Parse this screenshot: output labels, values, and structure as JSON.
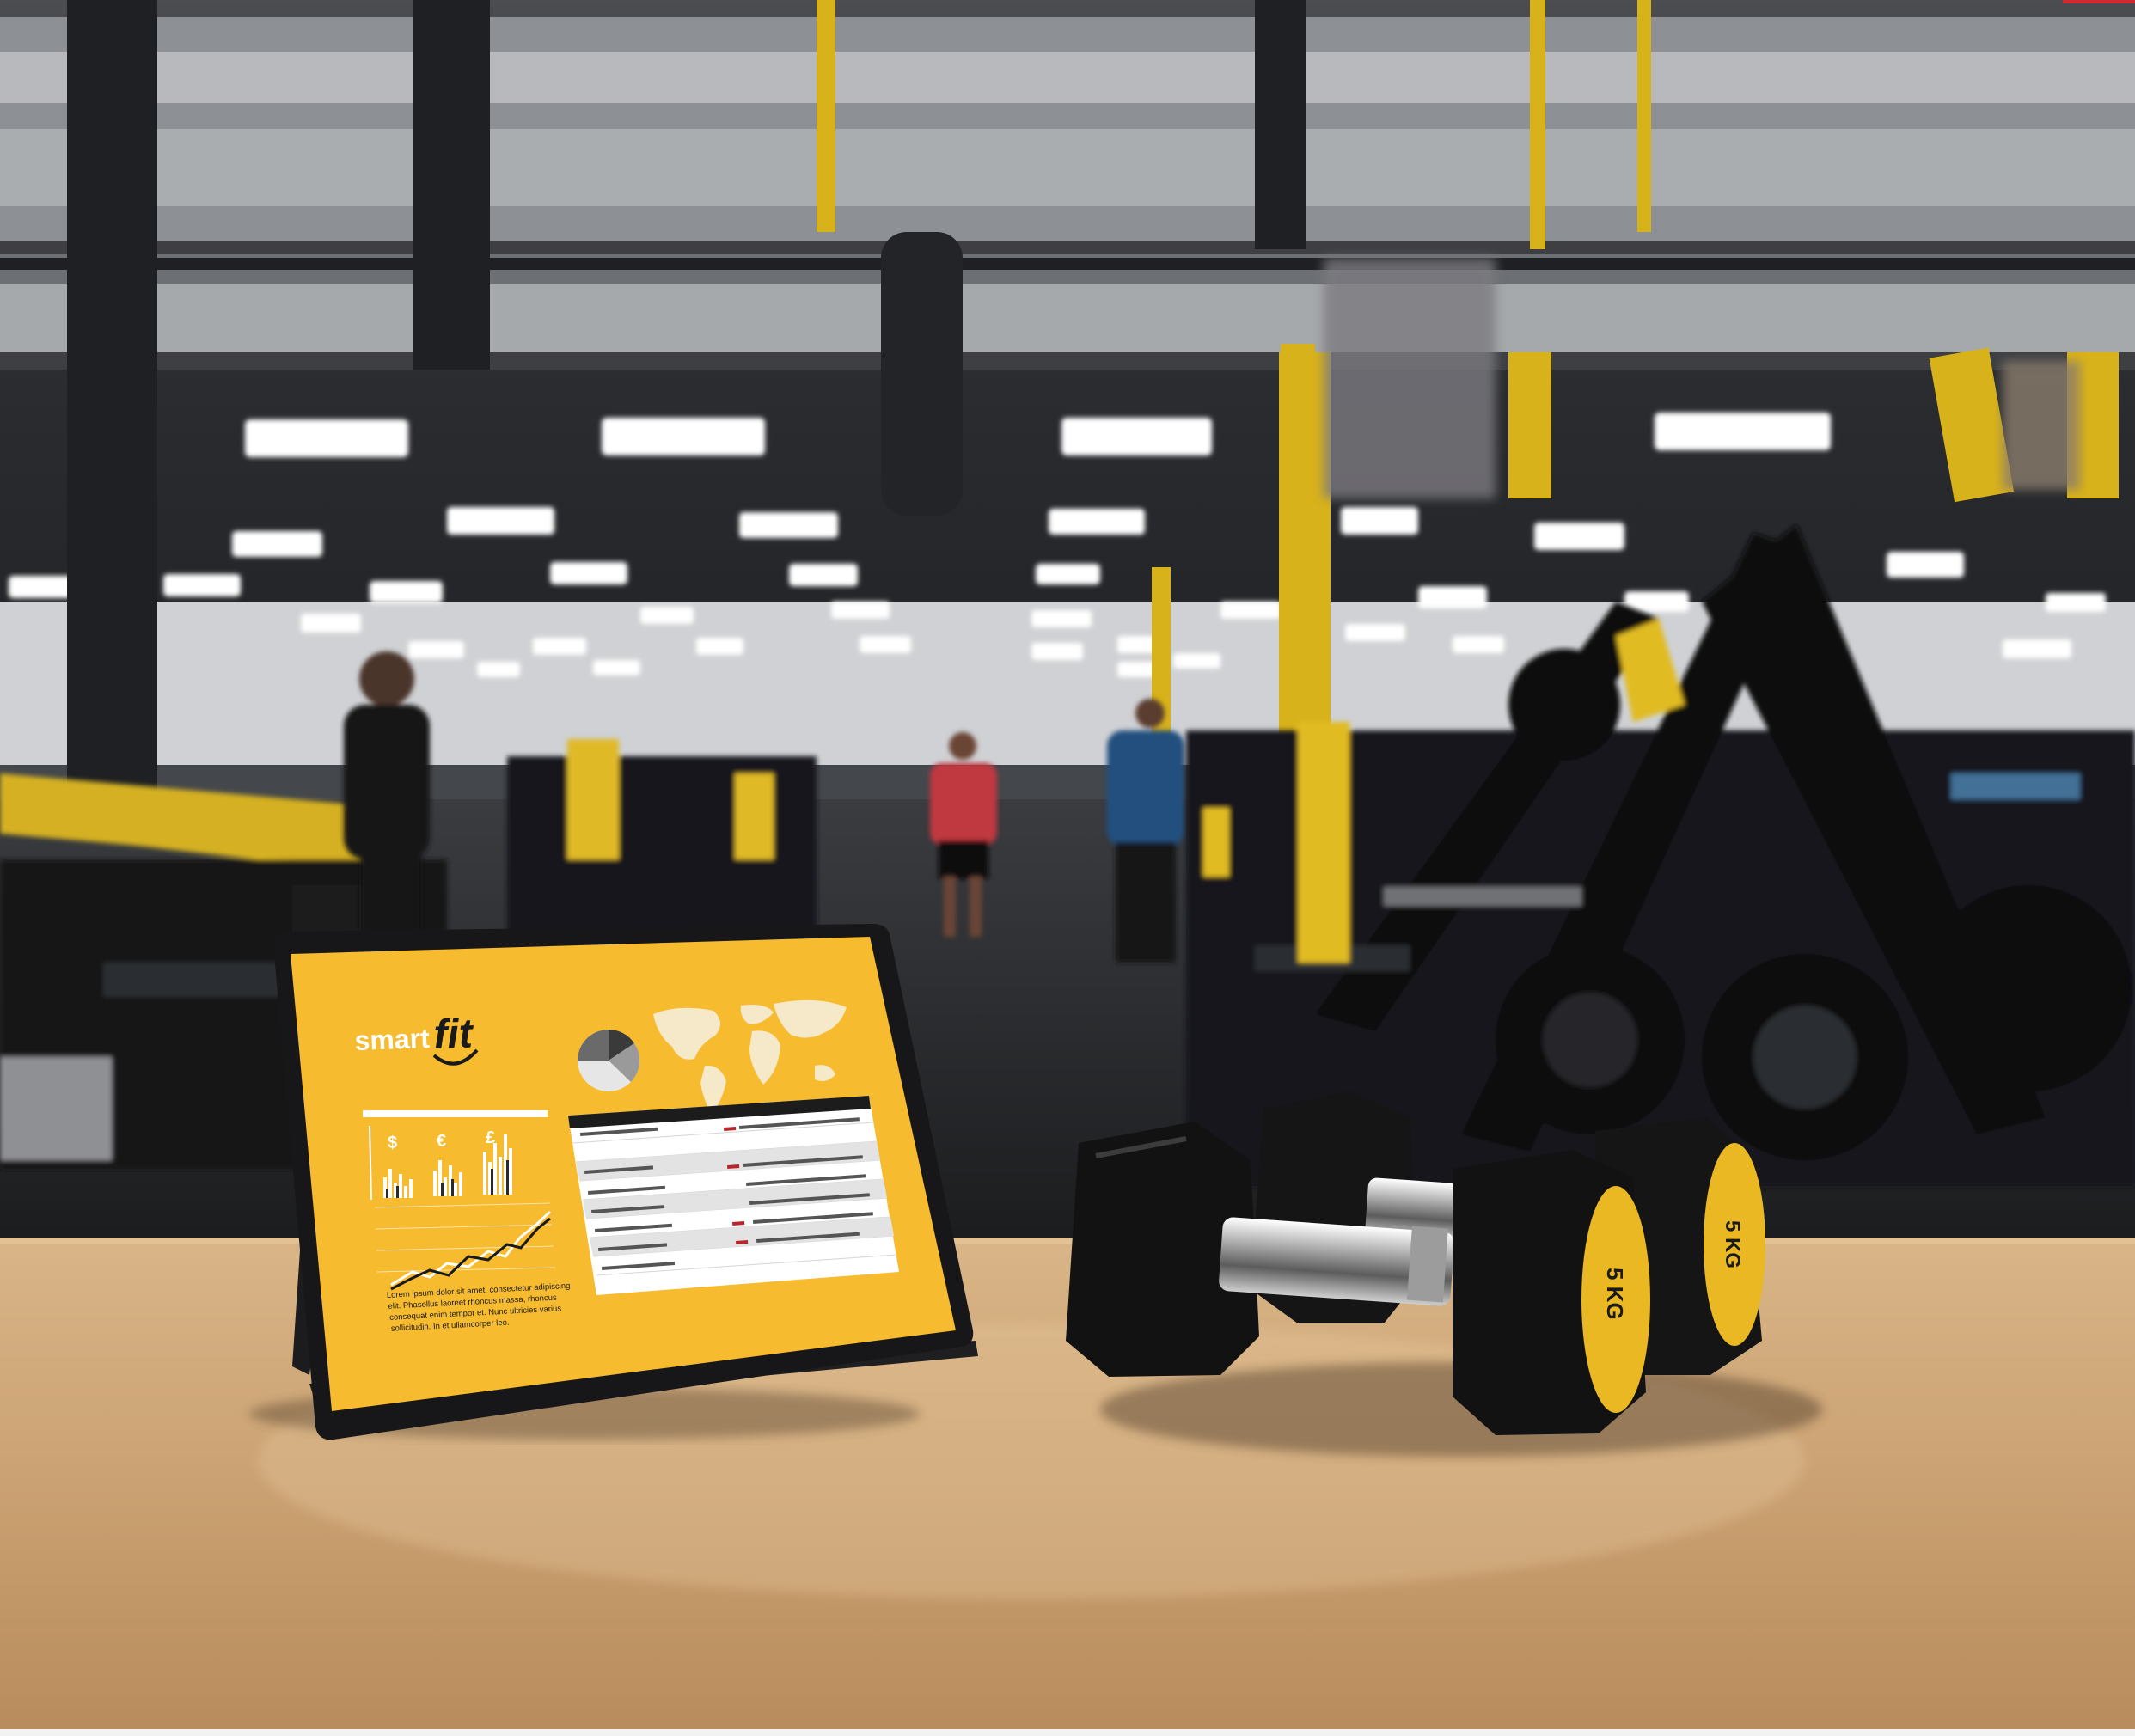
{
  "tablet_screen": {
    "brand_prefix": "smart",
    "brand_suffix": "fit",
    "currency_symbols": [
      "$",
      "€",
      "£"
    ],
    "lorem_lines": [
      "Lorem ipsum dolor sit amet, consectetur adipiscing",
      "elit. Phasellus laoreet rhoncus massa, rhoncus",
      "consequat enim tempor et. Nunc ultricies varius",
      "sollicitudin. In et ullamcorper leo."
    ]
  },
  "dumbbell_label": "5 KG",
  "colors": {
    "brand_yellow": "#f6bb2f",
    "equipment_yellow": "#e1bb20",
    "table_wood": "#cfa878",
    "rubber_black": "#151515"
  }
}
